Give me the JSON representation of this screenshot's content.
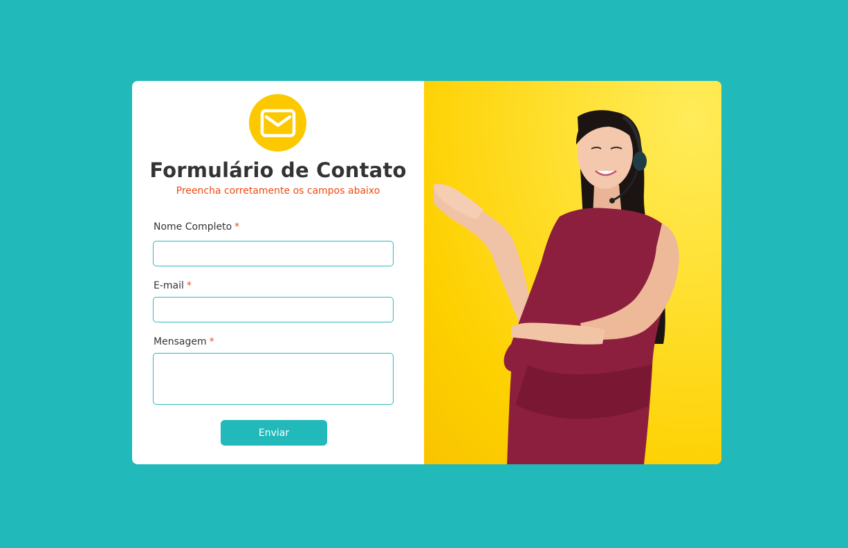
{
  "form": {
    "title": "Formulário de Contato",
    "subtitle": "Preencha corretamente os campos abaixo",
    "required_marker": "*",
    "fields": [
      {
        "label": "Nome Completo",
        "value": ""
      },
      {
        "label": "E-mail",
        "value": ""
      },
      {
        "label": "Mensagem",
        "value": ""
      }
    ],
    "submit_label": "Enviar"
  },
  "icons": {
    "header_icon": "mail-icon"
  },
  "colors": {
    "background": "#22b9bb",
    "accent": "#22b9bb",
    "badge": "#fcc800",
    "required": "#ef4a12",
    "photo_background": "#fdd000"
  }
}
